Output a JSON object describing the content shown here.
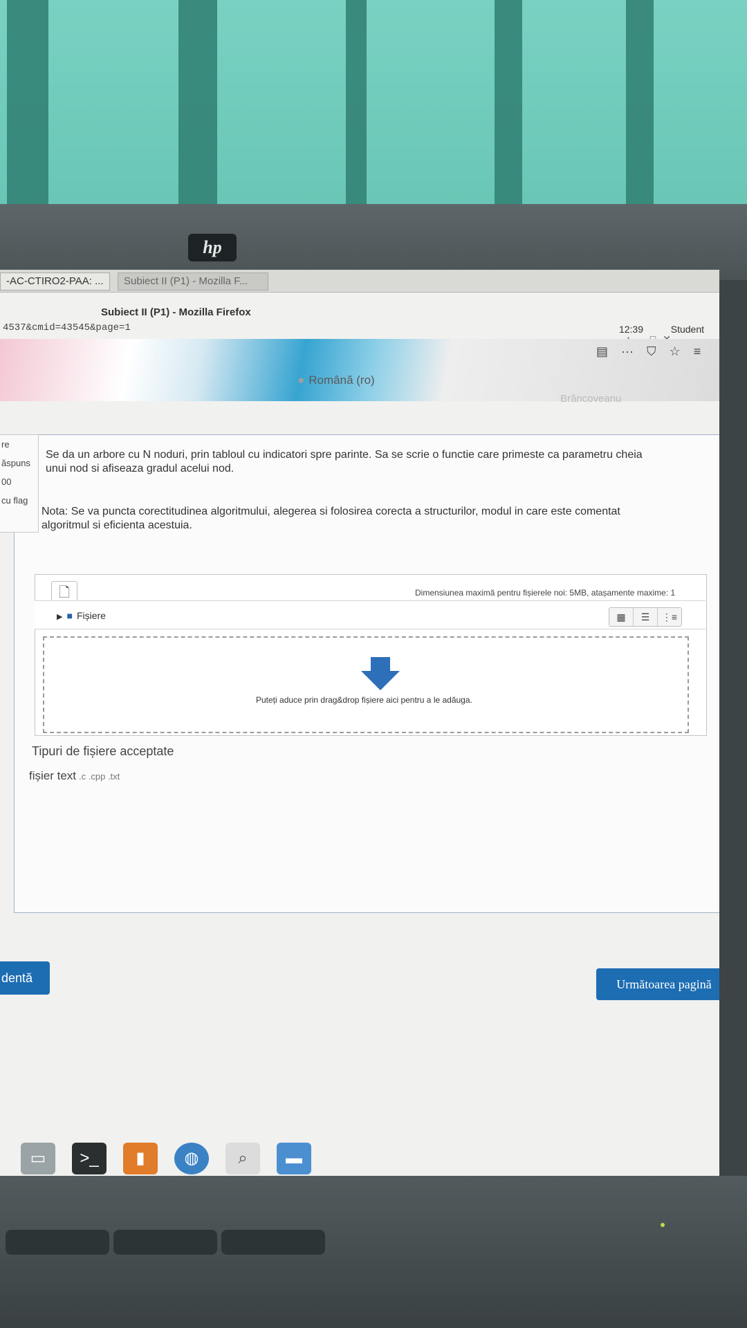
{
  "os_bar": {
    "tabs": [
      "-AC-CTIRO2-PAA: ...",
      "Subiect II (P1) - Mozilla F..."
    ],
    "clock": "12:39",
    "user": "Student"
  },
  "window": {
    "title": "Subiect II (P1) - Mozilla Firefox",
    "url_fragment": "4537&cmid=43545&page=1"
  },
  "header": {
    "language": "Română (ro)",
    "user_name": "Brâncoveanu"
  },
  "sidebar": {
    "items": [
      "re",
      "ăspuns",
      "00",
      "cu flag"
    ]
  },
  "question": {
    "text": "Se da un arbore cu N noduri, prin tabloul cu indicatori spre parinte. Sa se scrie o functie care primeste ca parametru cheia unui nod si afiseaza gradul acelui nod.",
    "note": "Nota: Se va puncta corectitudinea algoritmului, alegerea si folosirea corecta a structurilor, modul in care este comentat algoritmul si eficienta acestuia."
  },
  "file_picker": {
    "max_info": "Dimensiunea maximă pentru fișierele noi: 5MB, atașamente maxime: 1",
    "files_label": "Fișiere",
    "drop_text": "Puteți aduce prin drag&drop fișiere aici pentru a le adăuga.",
    "accepted_heading": "Tipuri de fișiere acceptate",
    "accepted_label": "fișier text",
    "accepted_ext": ".c .cpp .txt"
  },
  "nav": {
    "prev_label": "dentă",
    "next_label": "Următoarea pagină"
  },
  "colors": {
    "accent": "#1d6db3",
    "wall": "#5fb8a8",
    "drop_arrow": "#2d6fb8"
  },
  "icons": {
    "add_file": "file-add-icon",
    "folder": "folder-icon",
    "drop": "arrow-down-icon"
  }
}
